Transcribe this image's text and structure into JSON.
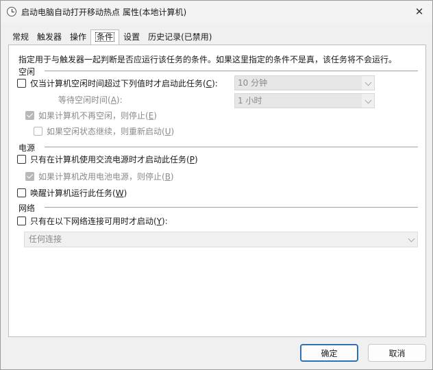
{
  "window": {
    "title": "启动电脑自动打开移动热点 属性(本地计算机)",
    "close_icon": "close-icon",
    "app_icon": "clock-icon"
  },
  "tabs": [
    {
      "label": "常规"
    },
    {
      "label": "触发器"
    },
    {
      "label": "操作"
    },
    {
      "label": "条件",
      "active": true
    },
    {
      "label": "设置"
    },
    {
      "label": "历史记录(已禁用)"
    }
  ],
  "panel": {
    "description": "指定用于与触发器一起判断是否应运行该任务的条件。如果这里指定的条件不是真，该任务将不会运行。",
    "idle": {
      "section": "空闲",
      "start_idle": {
        "label_pre": "仅当计算机空闲时间超过下列值时才启动此任务(",
        "key": "C",
        "label_post": "):",
        "checked": false
      },
      "idle_duration": "10 分钟",
      "wait_label_pre": "等待空闲时间(",
      "wait_key": "A",
      "wait_label_post": "):",
      "wait_timeout": "1 小时",
      "stop_on_idle_end": {
        "label_pre": "如果计算机不再空闲，则停止(",
        "key": "E",
        "label_post": ")",
        "checked": true,
        "disabled": true
      },
      "restart_on_idle": {
        "label_pre": "如果空闲状态继续，则重新启动(",
        "key": "U",
        "label_post": ")",
        "checked": false,
        "disabled": true
      }
    },
    "power": {
      "section": "电源",
      "ac_only": {
        "label_pre": "只有在计算机使用交流电源时才启动此任务(",
        "key": "P",
        "label_post": ")",
        "checked": false
      },
      "stop_on_battery": {
        "label_pre": "如果计算机改用电池电源，则停止(",
        "key": "B",
        "label_post": ")",
        "checked": true,
        "disabled": true
      },
      "wake": {
        "label_pre": "唤醒计算机运行此任务(",
        "key": "W",
        "label_post": ")",
        "checked": false
      }
    },
    "network": {
      "section": "网络",
      "network_only": {
        "label_pre": "只有在以下网络连接可用时才启动(",
        "key": "Y",
        "label_post": "):",
        "checked": false
      },
      "connection": "任何连接"
    }
  },
  "buttons": {
    "ok": "确定",
    "cancel": "取消"
  }
}
